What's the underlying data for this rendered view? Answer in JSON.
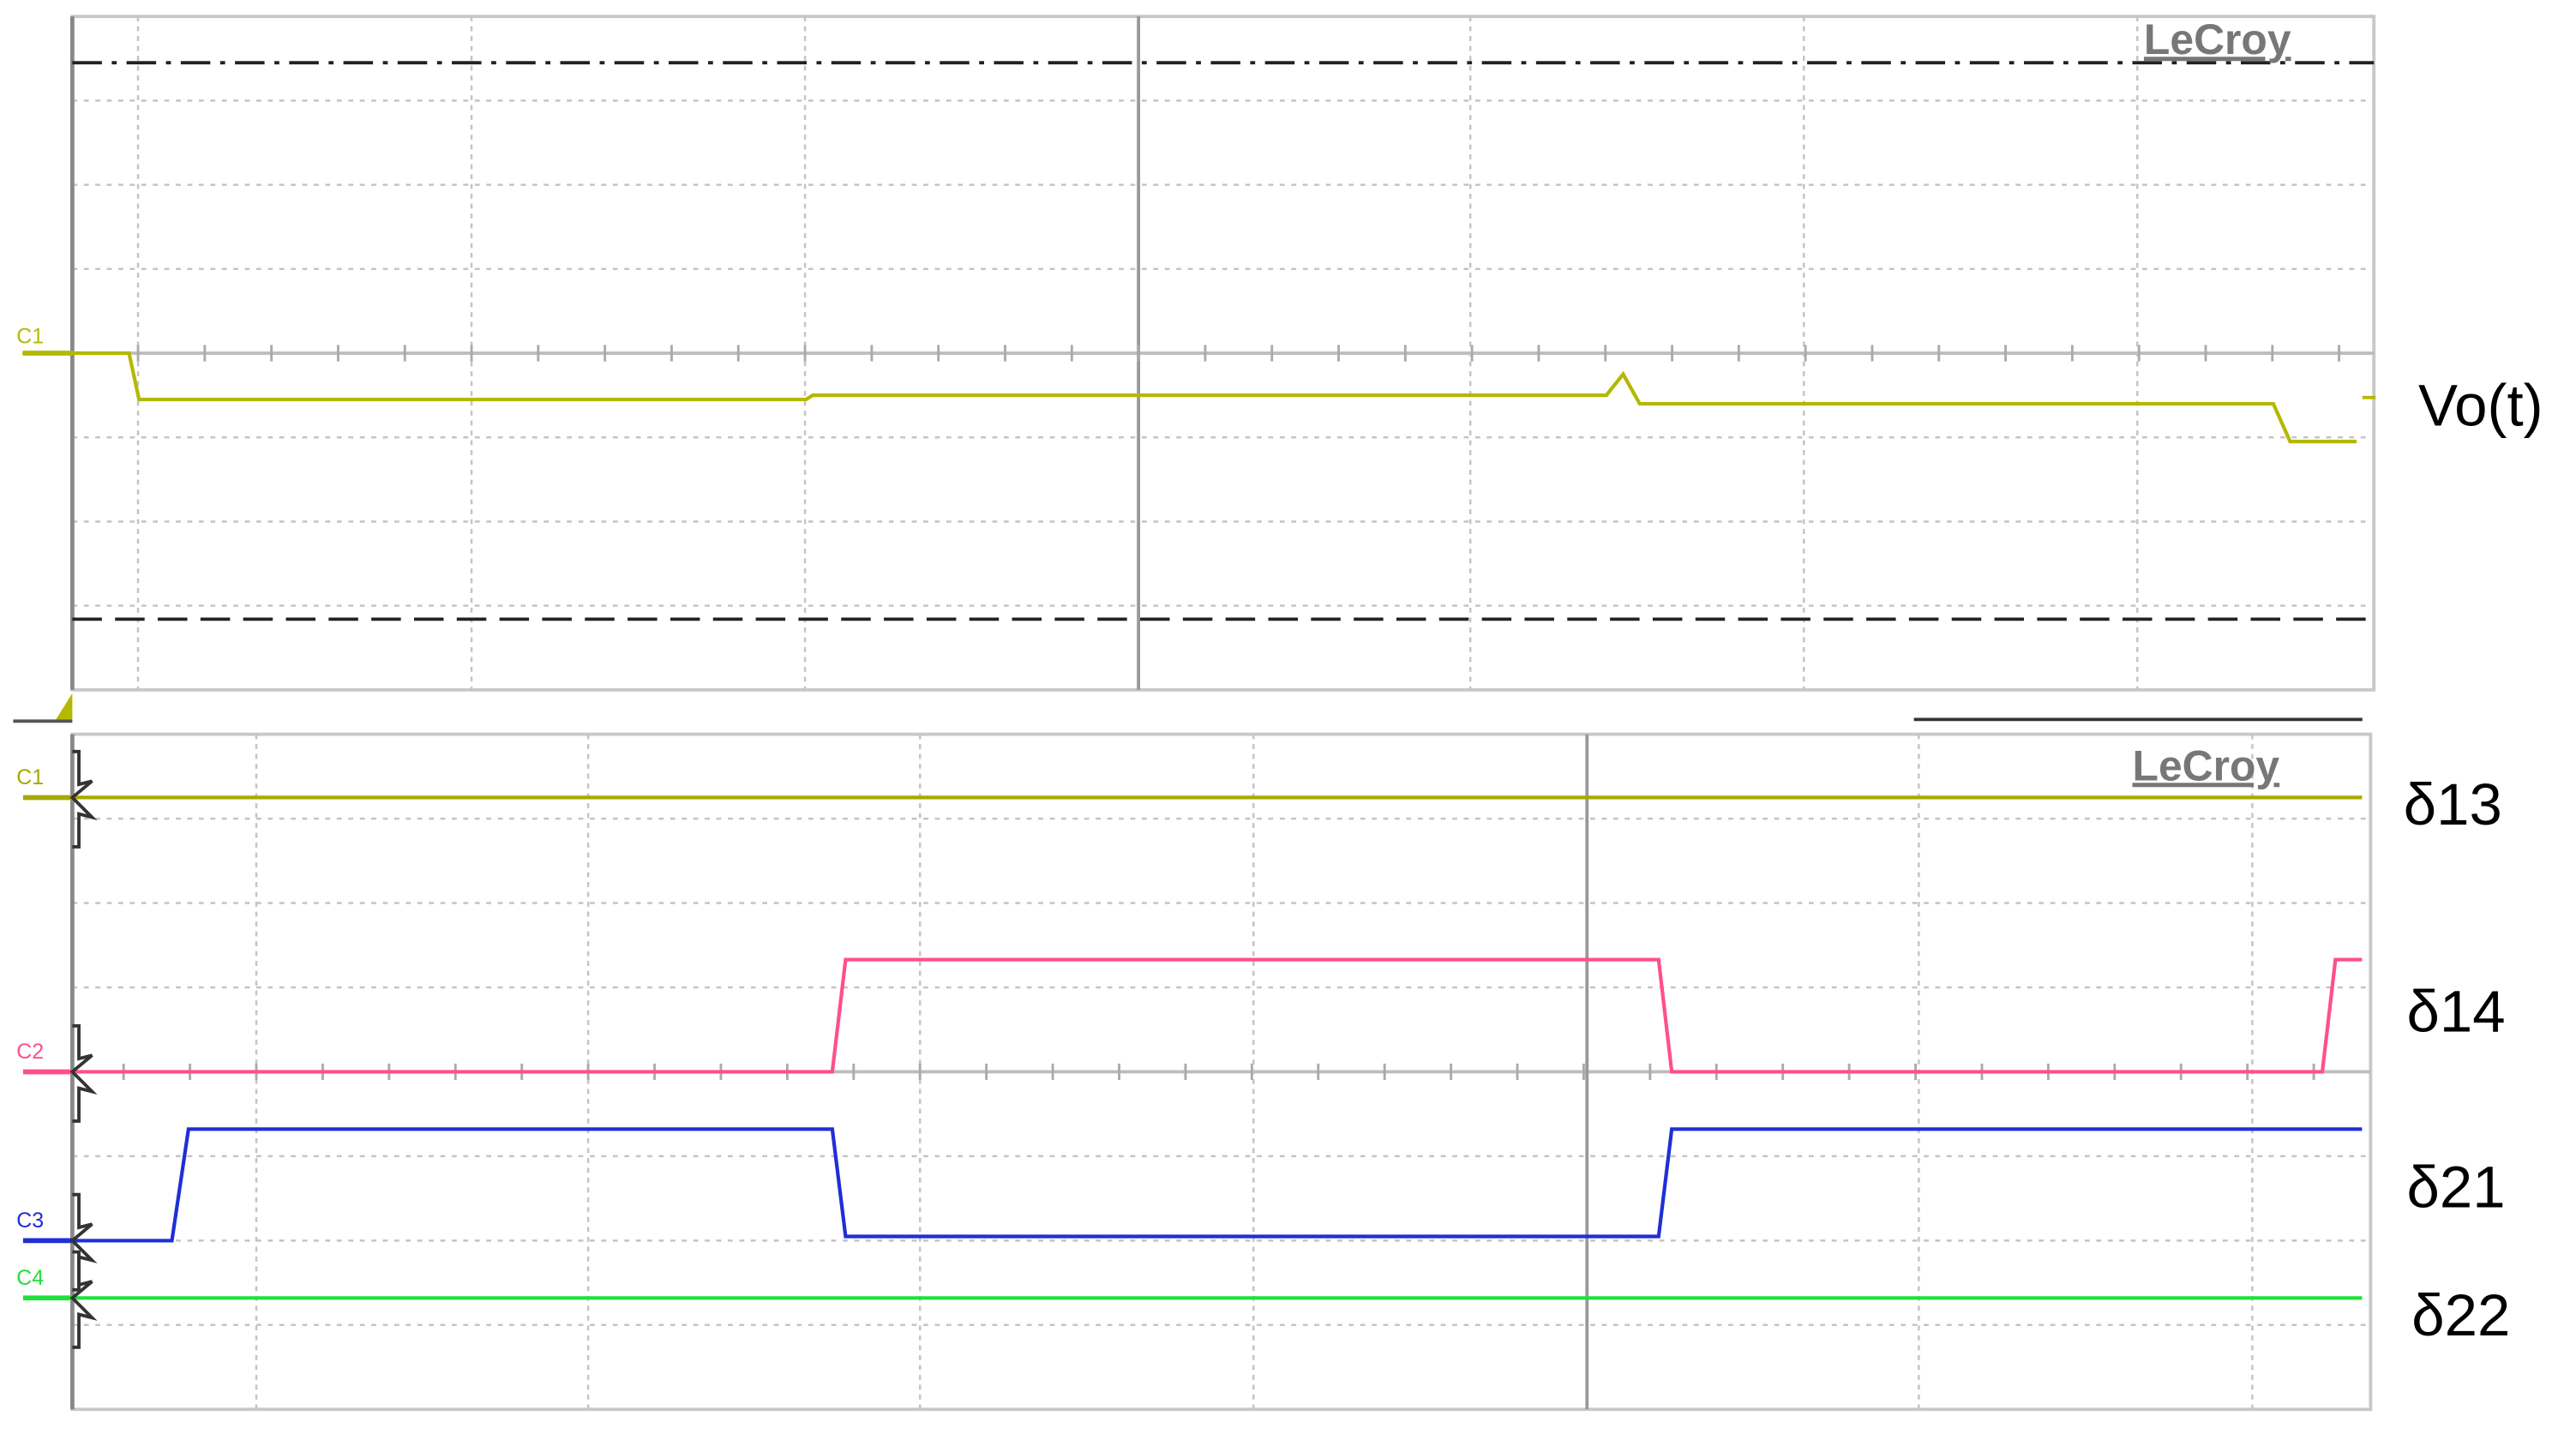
{
  "chart_data": [
    {
      "type": "line",
      "title": "Output voltage",
      "brand": "LeCroy",
      "xunit": "div",
      "yunit": "div",
      "xlim": [
        0,
        6.9
      ],
      "ylim": [
        -4,
        4
      ],
      "grid": true,
      "series": [
        {
          "name": "C1",
          "label": "Vo(t)",
          "color": "#b5b800",
          "points": [
            [
              -0.15,
              0
            ],
            [
              0.17,
              0
            ],
            [
              0.2,
              -0.55
            ],
            [
              2.2,
              -0.55
            ],
            [
              2.22,
              -0.5
            ],
            [
              4.6,
              -0.5
            ],
            [
              4.65,
              -0.25
            ],
            [
              4.7,
              -0.6
            ],
            [
              6.6,
              -0.6
            ],
            [
              6.65,
              -1.05
            ],
            [
              6.85,
              -1.05
            ]
          ]
        }
      ],
      "cursor_levels": [
        3.45,
        -3.16
      ]
    },
    {
      "type": "line",
      "title": "Switching signals",
      "brand": "LeCroy",
      "xunit": "div",
      "yunit": "div",
      "xlim": [
        0,
        6.9
      ],
      "ylim": [
        -4,
        4
      ],
      "grid": true,
      "series": [
        {
          "name": "C1",
          "label": "δ13",
          "color": "#a8a800",
          "points": [
            [
              0,
              3.25
            ],
            [
              6.9,
              3.25
            ]
          ]
        },
        {
          "name": "C2",
          "label": "δ14",
          "color": "#ff4f8b",
          "points": [
            [
              0,
              0
            ],
            [
              2.29,
              0
            ],
            [
              2.33,
              1.33
            ],
            [
              4.78,
              1.33
            ],
            [
              4.82,
              0
            ],
            [
              6.78,
              0
            ],
            [
              6.82,
              1.33
            ],
            [
              6.9,
              1.33
            ]
          ]
        },
        {
          "name": "C3",
          "label": "δ21",
          "color": "#1f2fd6",
          "points": [
            [
              0,
              -2
            ],
            [
              0.3,
              -2
            ],
            [
              0.35,
              -0.68
            ],
            [
              2.29,
              -0.68
            ],
            [
              2.33,
              -1.95
            ],
            [
              4.78,
              -1.95
            ],
            [
              4.82,
              -0.68
            ],
            [
              6.9,
              -0.68
            ]
          ]
        },
        {
          "name": "C4",
          "label": "δ22",
          "color": "#22e03a",
          "points": [
            [
              0,
              -2.68
            ],
            [
              6.9,
              -2.68
            ]
          ]
        }
      ]
    }
  ]
}
